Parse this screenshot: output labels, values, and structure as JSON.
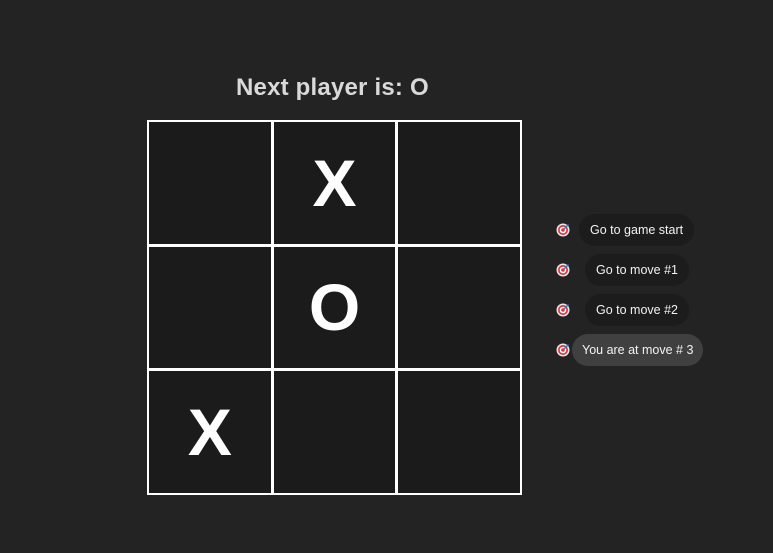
{
  "status": {
    "label": "Next player is: O"
  },
  "board": {
    "squares": [
      "",
      "X",
      "",
      "",
      "O",
      "",
      "X",
      "",
      ""
    ]
  },
  "history": {
    "items": [
      {
        "type": "button",
        "label": "Go to game start"
      },
      {
        "type": "button",
        "label": "Go to move #1"
      },
      {
        "type": "button",
        "label": "Go to move #2"
      },
      {
        "type": "current",
        "label": "You are at move # 3"
      }
    ],
    "marker_icon": "target-icon"
  },
  "colors": {
    "background": "#232323",
    "cell": "#1b1b1b",
    "grid_lines": "#ffffff",
    "button": "#1c1c1c",
    "current_badge": "#404040",
    "text": "#d9d9d9"
  }
}
